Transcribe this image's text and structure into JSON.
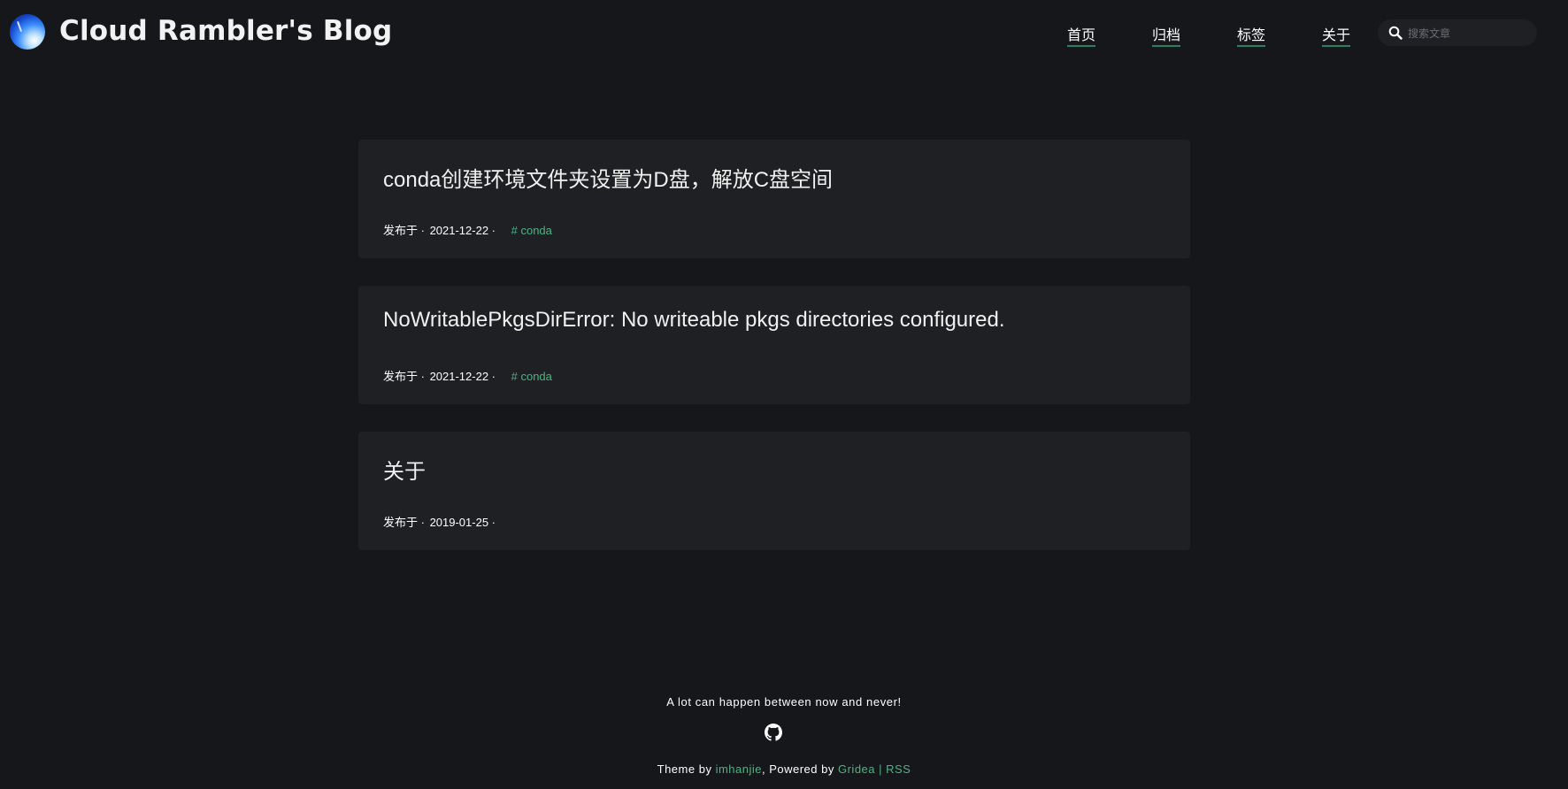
{
  "site": {
    "title": "Cloud Rambler's Blog"
  },
  "nav": {
    "items": [
      {
        "label": "首页"
      },
      {
        "label": "归档"
      },
      {
        "label": "标签"
      },
      {
        "label": "关于"
      }
    ]
  },
  "search": {
    "placeholder": "搜索文章",
    "value": ""
  },
  "posts": [
    {
      "title": "conda创建环境文件夹设置为D盘，解放C盘空间",
      "meta_prefix": "发布于 · ",
      "date": "2021-12-22",
      "meta_suffix": " · ",
      "tag": "# conda"
    },
    {
      "title": "NoWritablePkgsDirError: No writeable pkgs directories configured.",
      "meta_prefix": "发布于 · ",
      "date": "2021-12-22",
      "meta_suffix": " · ",
      "tag": "# conda"
    },
    {
      "title": "关于",
      "meta_prefix": "发布于 · ",
      "date": "2019-01-25",
      "meta_suffix": " · ",
      "tag": ""
    }
  ],
  "footer": {
    "quote": "A lot can happen between now and never!",
    "theme_by": "Theme by ",
    "theme_author": "imhanjie",
    "powered_by": ", Powered by ",
    "powered_name": "Gridea",
    "rss": " | RSS"
  },
  "colors": {
    "background": "#16171a",
    "card": "#1f2023",
    "accent": "#4fb383"
  },
  "icons": {
    "search": "search-icon",
    "github": "github-icon"
  }
}
